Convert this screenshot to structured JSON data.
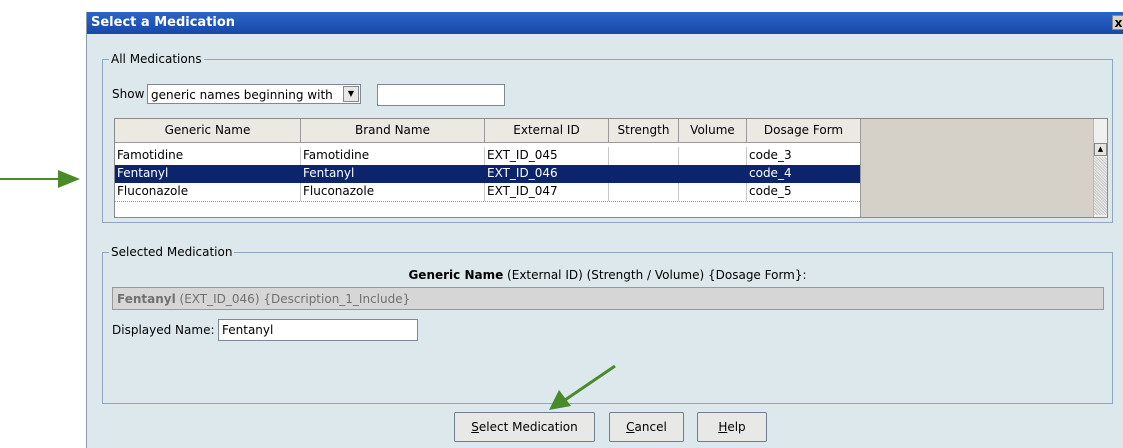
{
  "dialog": {
    "title": "Select a Medication",
    "close_glyph": "x"
  },
  "all_medications": {
    "legend": "All Medications",
    "show_label": "Show",
    "filter_mode": "generic names beginning with",
    "filter_text": ""
  },
  "table": {
    "columns": [
      "Generic Name",
      "Brand Name",
      "External ID",
      "Strength",
      "Volume",
      "Dosage Form"
    ],
    "rows": [
      {
        "generic": "Famotidine",
        "brand": "Famotidine",
        "external_id": "EXT_ID_045",
        "strength": "",
        "volume": "",
        "dosage_form": "code_3"
      },
      {
        "generic": "Fentanyl",
        "brand": "Fentanyl",
        "external_id": "EXT_ID_046",
        "strength": "",
        "volume": "",
        "dosage_form": "code_4"
      },
      {
        "generic": "Fluconazole",
        "brand": "Fluconazole",
        "external_id": "EXT_ID_047",
        "strength": "",
        "volume": "",
        "dosage_form": "code_5"
      }
    ],
    "selected_row": "Fentanyl"
  },
  "selected_medication": {
    "legend": "Selected Medication",
    "format_bold": "Generic Name",
    "format_rest": " (External ID)  (Strength / Volume)  {Dosage Form}:",
    "display_bold": "Fentanyl",
    "display_rest": " (EXT_ID_046) {Description_1_Include}",
    "displayed_name_label": "Displayed Name:",
    "displayed_name_value": "Fentanyl"
  },
  "buttons": {
    "select_medication": {
      "mnemonic": "S",
      "rest": "elect Medication"
    },
    "cancel": {
      "mnemonic": "C",
      "rest": "ancel"
    },
    "help": {
      "mnemonic": "H",
      "rest": "elp"
    }
  },
  "colors": {
    "dialog_bg": "#dde8ec",
    "title_bar": "#1c54b8",
    "selection": "#0b246b",
    "annotation_arrow": "#4a8a2a"
  },
  "icons": [
    "close-icon",
    "dropdown-arrow-icon",
    "scroll-up-icon",
    "annotation-arrow-icon"
  ]
}
